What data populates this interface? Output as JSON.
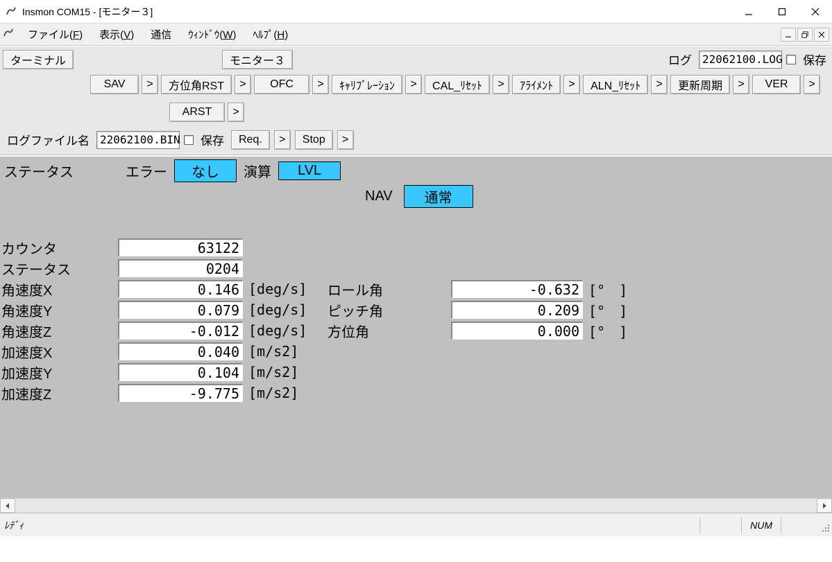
{
  "window": {
    "title": "Insmon COM15 - [モニター３]"
  },
  "menu": {
    "file": "ファイル(F)",
    "view": "表示(V)",
    "comm": "通信",
    "window": "ウィンドウ(W)",
    "help": "ヘルプ(H)"
  },
  "topbar": {
    "terminal_btn": "ターミナル",
    "monitor_btn": "モニター３",
    "log_label": "ログ",
    "log_file": "22062100.LOG",
    "save_label": "保存"
  },
  "cmds": {
    "sav": "SAV",
    "azrst": "方位角RST",
    "ofc": "OFC",
    "calib": "ｷｬﾘﾌﾞﾚｰｼｮﾝ",
    "calrst": "CAL_ﾘｾｯﾄ",
    "align": "ｱﾗｲﾒﾝﾄ",
    "alnrst": "ALN_ﾘｾｯﾄ",
    "refresh": "更新周期",
    "ver": "VER",
    "arst": "ARST",
    "arrow": ">"
  },
  "logrow": {
    "label": "ログファイル名",
    "file": "22062100.BIN",
    "save": "保存",
    "req": "Req.",
    "stop": "Stop"
  },
  "status": {
    "title": "ステータス",
    "err_label": "エラー",
    "err_val": "なし",
    "calc_label": "演算",
    "calc_val": "LVL",
    "nav_label": "NAV",
    "nav_val": "通常"
  },
  "meas": {
    "counter_label": "カウンタ",
    "counter": "63122",
    "status_label": "ステータス",
    "status": "0204",
    "gx_label": "角速度X",
    "gx": "0.146",
    "gx_u": "[deg/s]",
    "gy_label": "角速度Y",
    "gy": "0.079",
    "gy_u": "[deg/s]",
    "gz_label": "角速度Z",
    "gz": "-0.012",
    "gz_u": "[deg/s]",
    "ax_label": "加速度X",
    "ax": "0.040",
    "ax_u": "[m/s2]",
    "ay_label": "加速度Y",
    "ay": "0.104",
    "ay_u": "[m/s2]",
    "az_label": "加速度Z",
    "az": "-9.775",
    "az_u": "[m/s2]",
    "roll_label": "ロール角",
    "roll": "-0.632",
    "deg_u": "[°　]",
    "pitch_label": "ピッチ角",
    "pitch": "0.209",
    "yaw_label": "方位角",
    "yaw": "0.000"
  },
  "statusbar": {
    "ready": "ﾚﾃﾞｨ",
    "num": "NUM"
  }
}
